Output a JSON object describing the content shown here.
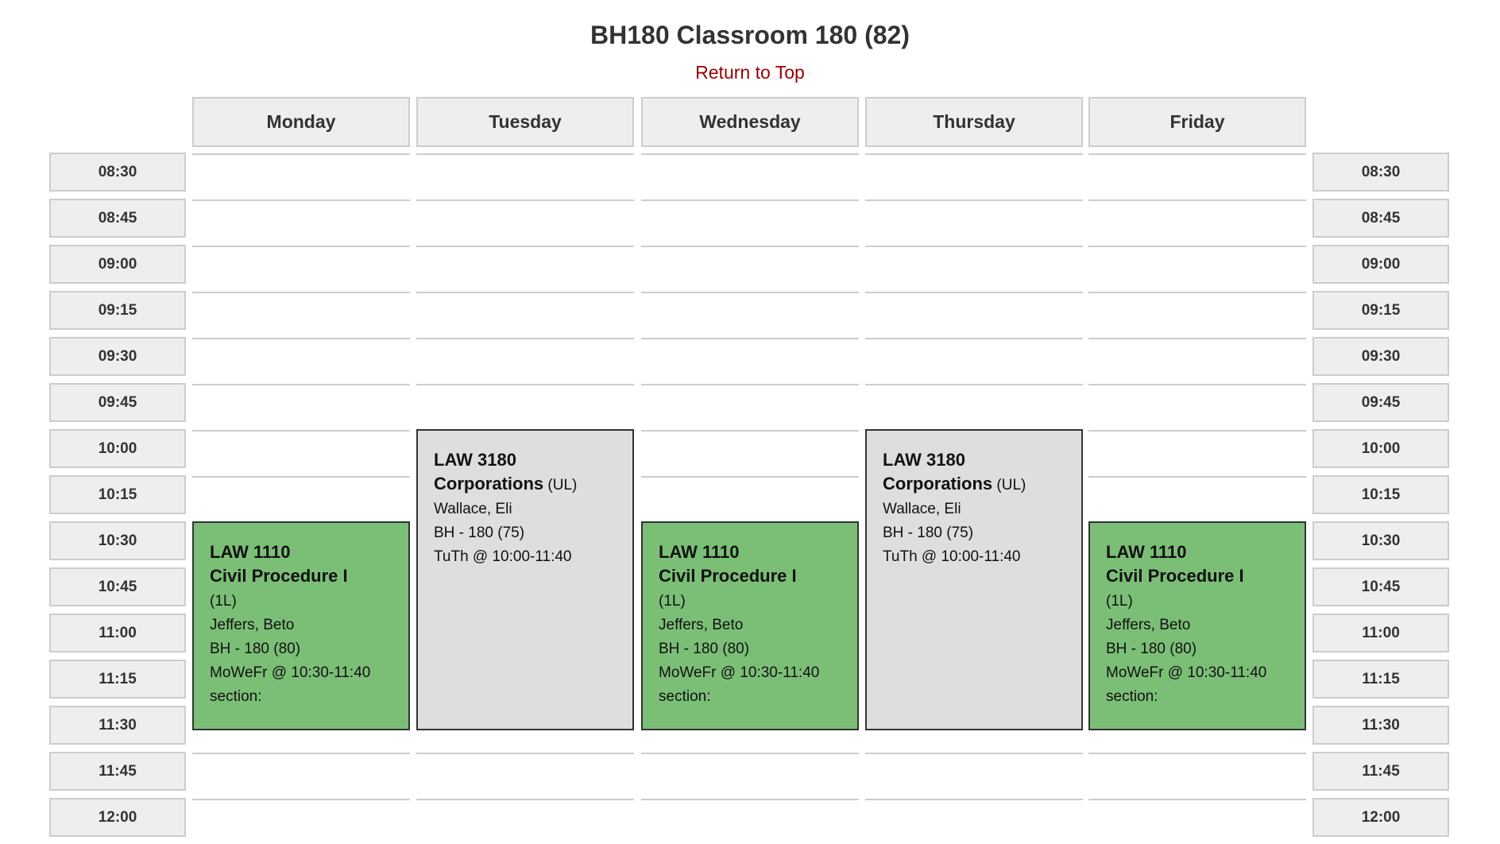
{
  "page": {
    "title": "BH180 Classroom 180 (82)",
    "return_link": "Return to Top"
  },
  "colors": {
    "link": "#990000",
    "header_bg": "#eeeeee",
    "course_1L": "#7bbf77",
    "course_UL": "#dedede"
  },
  "days": [
    "Monday",
    "Tuesday",
    "Wednesday",
    "Thursday",
    "Friday"
  ],
  "times": [
    "08:30",
    "08:45",
    "09:00",
    "09:15",
    "09:30",
    "09:45",
    "10:00",
    "10:15",
    "10:30",
    "10:45",
    "11:00",
    "11:15",
    "11:30",
    "11:45",
    "12:00"
  ],
  "courses": [
    {
      "day": "Monday",
      "code": "LAW 1110",
      "name": "Civil Procedure I",
      "tag": "(1L)",
      "instructor": "Jeffers, Beto",
      "room": "BH - 180 (80)",
      "schedule": "MoWeFr @ 10:30-11:40",
      "section": "section:",
      "start": "10:30",
      "end": "11:40",
      "color": "green"
    },
    {
      "day": "Tuesday",
      "code": "LAW 3180",
      "name": "Corporations",
      "tag": "(UL)",
      "instructor": "Wallace, Eli",
      "room": "BH - 180 (75)",
      "schedule": "TuTh @ 10:00-11:40",
      "start": "10:00",
      "end": "11:40",
      "color": "gray"
    },
    {
      "day": "Wednesday",
      "code": "LAW 1110",
      "name": "Civil Procedure I",
      "tag": "(1L)",
      "instructor": "Jeffers, Beto",
      "room": "BH - 180 (80)",
      "schedule": "MoWeFr @ 10:30-11:40",
      "section": "section:",
      "start": "10:30",
      "end": "11:40",
      "color": "green"
    },
    {
      "day": "Thursday",
      "code": "LAW 3180",
      "name": "Corporations",
      "tag": "(UL)",
      "instructor": "Wallace, Eli",
      "room": "BH - 180 (75)",
      "schedule": "TuTh @ 10:00-11:40",
      "start": "10:00",
      "end": "11:40",
      "color": "gray"
    },
    {
      "day": "Friday",
      "code": "LAW 1110",
      "name": "Civil Procedure I",
      "tag": "(1L)",
      "instructor": "Jeffers, Beto",
      "room": "BH - 180 (80)",
      "schedule": "MoWeFr @ 10:30-11:40",
      "section": "section:",
      "start": "10:30",
      "end": "11:40",
      "color": "green"
    }
  ]
}
